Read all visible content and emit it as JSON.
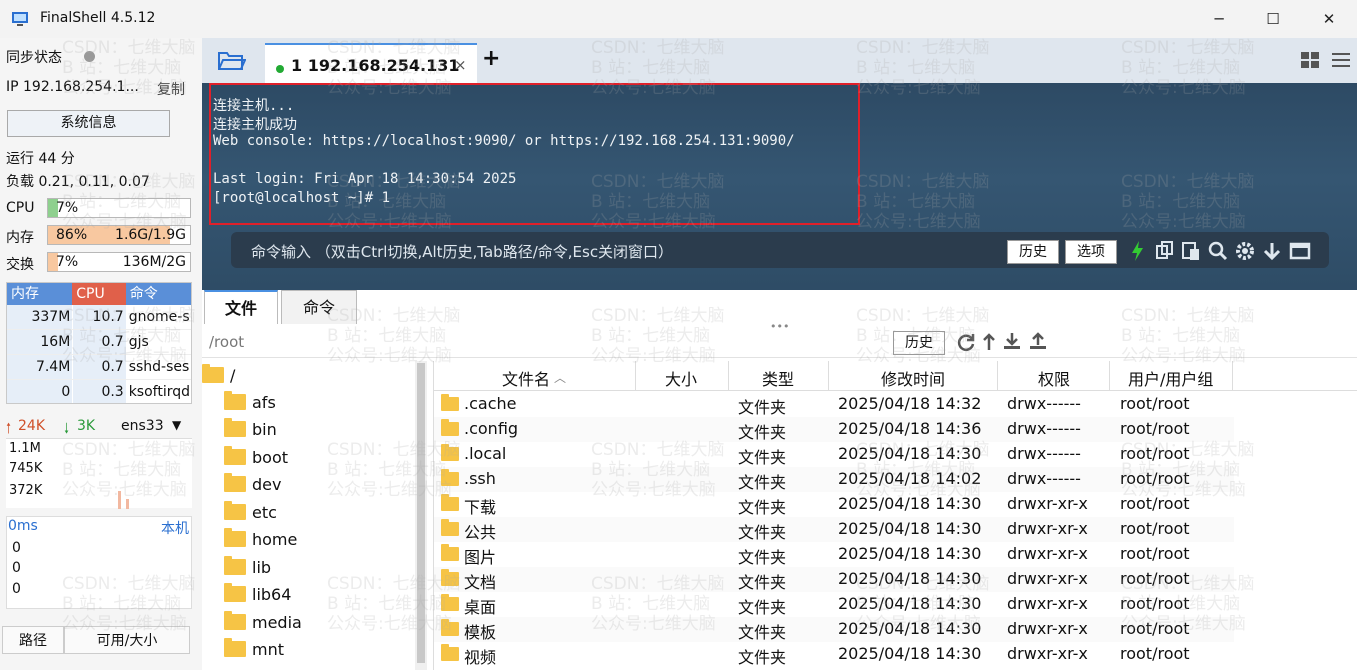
{
  "window": {
    "title": "FinalShell 4.5.12",
    "minimize": "─",
    "maximize": "☐",
    "close": "✕"
  },
  "left": {
    "sync_label": "同步状态",
    "ip_label": "IP  192.168.254.1...",
    "copy_label": "复制",
    "sysinfo_label": "系统信息",
    "runtime": "运行 44 分",
    "load": "负载 0.21, 0.11, 0.07",
    "cpu": {
      "label": "CPU",
      "pct": "7%",
      "value": "",
      "level": 0.07
    },
    "mem": {
      "label": "内存",
      "pct": "86%",
      "value": "1.6G/1.9G",
      "level": 0.86
    },
    "swap": {
      "label": "交换",
      "pct": "7%",
      "value": "136M/2G",
      "level": 0.07
    },
    "proc_headers": [
      "内存",
      "CPU",
      "命令"
    ],
    "processes": [
      {
        "mem": "337M",
        "cpu": "10.7",
        "cmd": "gnome-s"
      },
      {
        "mem": "16M",
        "cpu": "0.7",
        "cmd": "gjs"
      },
      {
        "mem": "7.4M",
        "cpu": "0.7",
        "cmd": "sshd-ses"
      },
      {
        "mem": "0",
        "cpu": "0.3",
        "cmd": "ksoftirqd"
      }
    ],
    "net": {
      "up": "24K",
      "down": "3K",
      "iface": "ens33",
      "y_labels": [
        "1.1M",
        "745K",
        "372K"
      ]
    },
    "ping": {
      "ms": "0ms",
      "host": "本机",
      "values": [
        "0",
        "0",
        "0"
      ]
    },
    "bottom_tabs": [
      "路径",
      "可用/大小"
    ]
  },
  "tabs": {
    "session": "1 192.168.254.131",
    "close": "×",
    "add": "+"
  },
  "terminal": {
    "lines": [
      "连接主机...",
      "连接主机成功",
      "Web console: https://localhost:9090/ or https://192.168.254.131:9090/",
      "",
      "Last login: Fri Apr 18 14:30:54 2025",
      "[root@localhost ~]# 1"
    ],
    "cmd_hint": "命令输入 （双击Ctrl切换,Alt历史,Tab路径/命令,Esc关闭窗口）",
    "history_btn": "历史",
    "options_btn": "选项"
  },
  "file_tabs": [
    "文件",
    "命令"
  ],
  "path": {
    "value": "/root",
    "history_btn": "历史"
  },
  "tree": [
    "/",
    "afs",
    "bin",
    "boot",
    "dev",
    "etc",
    "home",
    "lib",
    "lib64",
    "media",
    "mnt"
  ],
  "files": {
    "headers": [
      "文件名",
      "大小",
      "类型",
      "修改时间",
      "权限",
      "用户/用户组"
    ],
    "rows": [
      {
        "name": ".cache",
        "size": "",
        "type": "文件夹",
        "mtime": "2025/04/18 14:32",
        "perm": "drwx------",
        "owner": "root/root"
      },
      {
        "name": ".config",
        "size": "",
        "type": "文件夹",
        "mtime": "2025/04/18 14:36",
        "perm": "drwx------",
        "owner": "root/root"
      },
      {
        "name": ".local",
        "size": "",
        "type": "文件夹",
        "mtime": "2025/04/18 14:30",
        "perm": "drwx------",
        "owner": "root/root"
      },
      {
        "name": ".ssh",
        "size": "",
        "type": "文件夹",
        "mtime": "2025/04/18 14:02",
        "perm": "drwx------",
        "owner": "root/root"
      },
      {
        "name": "下载",
        "size": "",
        "type": "文件夹",
        "mtime": "2025/04/18 14:30",
        "perm": "drwxr-xr-x",
        "owner": "root/root"
      },
      {
        "name": "公共",
        "size": "",
        "type": "文件夹",
        "mtime": "2025/04/18 14:30",
        "perm": "drwxr-xr-x",
        "owner": "root/root"
      },
      {
        "name": "图片",
        "size": "",
        "type": "文件夹",
        "mtime": "2025/04/18 14:30",
        "perm": "drwxr-xr-x",
        "owner": "root/root"
      },
      {
        "name": "文档",
        "size": "",
        "type": "文件夹",
        "mtime": "2025/04/18 14:30",
        "perm": "drwxr-xr-x",
        "owner": "root/root"
      },
      {
        "name": "桌面",
        "size": "",
        "type": "文件夹",
        "mtime": "2025/04/18 14:30",
        "perm": "drwxr-xr-x",
        "owner": "root/root"
      },
      {
        "name": "模板",
        "size": "",
        "type": "文件夹",
        "mtime": "2025/04/18 14:30",
        "perm": "drwxr-xr-x",
        "owner": "root/root"
      },
      {
        "name": "视频",
        "size": "",
        "type": "文件夹",
        "mtime": "2025/04/18 14:30",
        "perm": "drwxr-xr-x",
        "owner": "root/root"
      }
    ]
  },
  "watermark": [
    "CSDN：七维大脑",
    "B 站：七维大脑",
    "公众号:七维大脑"
  ],
  "colors": {
    "accent": "#4a90e2",
    "mem_bar": "#f8c8a0",
    "cpu_bar": "#8ed08e",
    "highlight": "#e0202a",
    "proc_mem_head": "#5a8fd8",
    "proc_cpu_head": "#e0604a",
    "proc_cmd_head": "#5a8fd8",
    "folder": "#f6c445"
  }
}
